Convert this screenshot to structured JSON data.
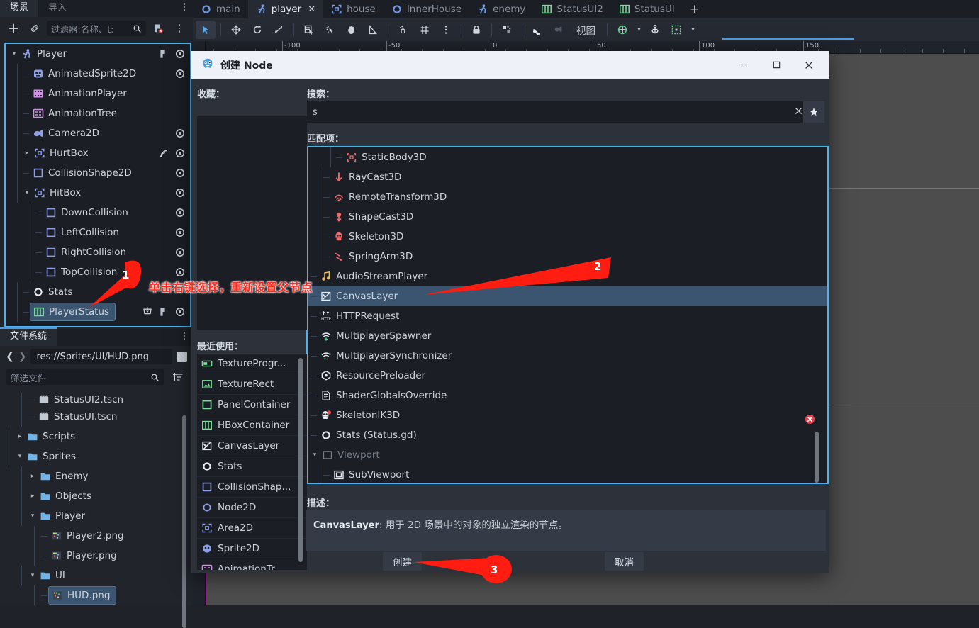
{
  "scene_dock": {
    "tabs": [
      {
        "label": "场景",
        "active": true
      },
      {
        "label": "导入",
        "active": false
      }
    ],
    "toolbar": {
      "add_label": "+",
      "link_icon": "link-icon",
      "filter_placeholder": "过滤器:名称、t:",
      "search_icon": "search-icon",
      "script_icon": "script-remove-icon",
      "menu_icon": "kebab-menu-icon"
    },
    "nodes": [
      {
        "name": "Player",
        "depth": 0,
        "icon": "player-node-icon",
        "icon_color": "#8f9fe8",
        "expand": "down",
        "eye": true,
        "script": true,
        "signal": false
      },
      {
        "name": "AnimatedSprite2D",
        "depth": 1,
        "icon": "animated-sprite-icon",
        "icon_color": "#8f9fe8",
        "expand": "leaf",
        "eye": true,
        "script": false,
        "signal": false
      },
      {
        "name": "AnimationPlayer",
        "depth": 1,
        "icon": "animation-player-icon",
        "icon_color": "#d48fe8",
        "expand": "leaf",
        "eye": false,
        "script": false,
        "signal": false
      },
      {
        "name": "AnimationTree",
        "depth": 1,
        "icon": "animation-tree-icon",
        "icon_color": "#d48fe8",
        "expand": "leaf",
        "eye": false,
        "script": false,
        "signal": false
      },
      {
        "name": "Camera2D",
        "depth": 1,
        "icon": "camera-2d-icon",
        "icon_color": "#8f9fe8",
        "expand": "leaf",
        "eye": true,
        "script": false,
        "signal": false
      },
      {
        "name": "HurtBox",
        "depth": 1,
        "icon": "area-2d-icon",
        "icon_color": "#8f9fe8",
        "expand": "right",
        "eye": true,
        "script": false,
        "signal": true
      },
      {
        "name": "CollisionShape2D",
        "depth": 1,
        "icon": "collision-shape-icon",
        "icon_color": "#8f9fe8",
        "expand": "leaf",
        "eye": true,
        "script": false,
        "signal": false
      },
      {
        "name": "HitBox",
        "depth": 1,
        "icon": "area-2d-icon",
        "icon_color": "#8f9fe8",
        "expand": "down",
        "eye": true,
        "script": false,
        "signal": false
      },
      {
        "name": "DownCollision",
        "depth": 2,
        "icon": "collision-shape-icon",
        "icon_color": "#8f9fe8",
        "expand": "leaf",
        "eye": true,
        "script": false,
        "signal": false
      },
      {
        "name": "LeftCollision",
        "depth": 2,
        "icon": "collision-shape-icon",
        "icon_color": "#8f9fe8",
        "expand": "leaf",
        "eye": true,
        "script": false,
        "signal": false
      },
      {
        "name": "RightCollision",
        "depth": 2,
        "icon": "collision-shape-icon",
        "icon_color": "#8f9fe8",
        "expand": "leaf",
        "eye": true,
        "script": false,
        "signal": false
      },
      {
        "name": "TopCollision",
        "depth": 2,
        "icon": "collision-shape-icon",
        "icon_color": "#8f9fe8",
        "expand": "leaf",
        "eye": true,
        "script": false,
        "signal": false
      },
      {
        "name": "Stats",
        "depth": 1,
        "icon": "node-circle-icon",
        "icon_color": "#e8ecf2",
        "expand": "leaf",
        "eye": false,
        "script": false,
        "signal": false
      },
      {
        "name": "PlayerStatus",
        "depth": 1,
        "icon": "hbox-container-icon",
        "icon_color": "#7ce09a",
        "expand": "leaf",
        "eye": true,
        "script": true,
        "signal": false,
        "selected": true,
        "preview": true
      }
    ]
  },
  "filesystem_dock": {
    "tabs": [
      {
        "label": "文件系统",
        "active": true
      }
    ],
    "path_value": "res://Sprites/UI/HUD.png",
    "back_icon": "chevron-left-icon",
    "forward_icon": "chevron-right-icon",
    "filter_placeholder": "筛选文件",
    "search_icon": "search-icon",
    "sort_icon": "sort-icon",
    "entries": [
      {
        "name": "StatusUI2.tscn",
        "depth": 2,
        "kind": "scene",
        "expand": "leaf",
        "clipped": true
      },
      {
        "name": "StatusUI.tscn",
        "depth": 2,
        "kind": "scene",
        "expand": "leaf"
      },
      {
        "name": "Scripts",
        "depth": 1,
        "kind": "folder",
        "expand": "right"
      },
      {
        "name": "Sprites",
        "depth": 1,
        "kind": "folder",
        "expand": "down"
      },
      {
        "name": "Enemy",
        "depth": 2,
        "kind": "folder",
        "expand": "right"
      },
      {
        "name": "Objects",
        "depth": 2,
        "kind": "folder",
        "expand": "right"
      },
      {
        "name": "Player",
        "depth": 2,
        "kind": "folder",
        "expand": "down"
      },
      {
        "name": "Player2.png",
        "depth": 3,
        "kind": "image",
        "expand": "leaf"
      },
      {
        "name": "Player.png",
        "depth": 3,
        "kind": "image",
        "expand": "leaf"
      },
      {
        "name": "UI",
        "depth": 2,
        "kind": "folder",
        "expand": "down"
      },
      {
        "name": "HUD.png",
        "depth": 3,
        "kind": "image",
        "expand": "leaf",
        "selected": true
      }
    ]
  },
  "editor": {
    "scene_tabs": [
      {
        "label": "main",
        "icon": "node-circle-icon",
        "icon_color": "#6f9ae8",
        "active": false,
        "closable": false
      },
      {
        "label": "player",
        "icon": "player-node-icon",
        "icon_color": "#6f9ae8",
        "active": true,
        "closable": true
      },
      {
        "label": "house",
        "icon": "area-2d-icon",
        "icon_color": "#6f9ae8",
        "active": false,
        "closable": false
      },
      {
        "label": "InnerHouse",
        "icon": "node-circle-icon",
        "icon_color": "#6f9ae8",
        "active": false,
        "closable": false
      },
      {
        "label": "enemy",
        "icon": "player-node-icon",
        "icon_color": "#6f9ae8",
        "active": false,
        "closable": false
      },
      {
        "label": "StatusUI2",
        "icon": "hbox-container-icon",
        "icon_color": "#7ce09a",
        "active": false,
        "closable": false
      },
      {
        "label": "StatusUI",
        "icon": "hbox-container-icon",
        "icon_color": "#7ce09a",
        "active": false,
        "closable": false
      }
    ],
    "add_tab_label": "+",
    "toolbar": {
      "tools": [
        {
          "name": "select-tool-icon",
          "active": true
        },
        {
          "name": "move-tool-icon",
          "active": false
        },
        {
          "name": "rotate-tool-icon",
          "active": false
        },
        {
          "name": "scale-tool-icon",
          "active": false
        },
        {
          "name": "list-select-icon",
          "active": false
        },
        {
          "name": "ruler-select-icon",
          "active": false
        },
        {
          "name": "pan-tool-icon",
          "active": false
        },
        {
          "name": "ruler-tool-icon",
          "active": false
        },
        {
          "name": "snap-mode-icon",
          "active": false
        },
        {
          "name": "grid-snap-icon",
          "active": false
        },
        {
          "name": "snap-options-icon",
          "active": false
        },
        {
          "name": "lock-icon",
          "active": false
        },
        {
          "name": "group-icon",
          "active": false
        },
        {
          "name": "bone-icon",
          "active": false
        },
        {
          "name": "skeleton-options-icon",
          "active": false
        }
      ],
      "view_menu_label": "视图",
      "origin_icon": "origin-center-icon",
      "anchor_icon": "anchor-icon",
      "grid_icon": "grid-visibility-icon",
      "chevron_icon": "chevron-down-icon"
    },
    "ruler": {
      "h_ticks": [
        "-100",
        "-50",
        "0",
        "50",
        "100",
        "150"
      ]
    }
  },
  "dialog": {
    "title": "创建 Node",
    "icon": "godot-logo-icon",
    "window_buttons": {
      "minimize": "—",
      "maximize": "☐",
      "close": "✕"
    },
    "favorites_label": "收藏：",
    "search_label": "搜索：",
    "search_value": "s",
    "clear_icon": "clear-x-icon",
    "favorite_icon": "star-icon",
    "matches_label": "匹配项：",
    "recent_label": "最近使用：",
    "recent_items": [
      {
        "name": "TextureProgr...",
        "icon": "texture-progress-icon",
        "icon_color": "#7ce09a"
      },
      {
        "name": "TextureRect",
        "icon": "texture-rect-icon",
        "icon_color": "#7ce09a"
      },
      {
        "name": "PanelContainer",
        "icon": "panel-container-icon",
        "icon_color": "#7ce09a"
      },
      {
        "name": "HBoxContainer",
        "icon": "hbox-container-icon",
        "icon_color": "#7ce09a"
      },
      {
        "name": "CanvasLayer",
        "icon": "canvas-layer-icon",
        "icon_color": "#e8ecf2"
      },
      {
        "name": "Stats",
        "icon": "node-circle-icon",
        "icon_color": "#e8ecf2"
      },
      {
        "name": "CollisionShap...",
        "icon": "collision-shape-icon",
        "icon_color": "#8f9fe8"
      },
      {
        "name": "Node2D",
        "icon": "node-2d-icon",
        "icon_color": "#8f9fe8"
      },
      {
        "name": "Area2D",
        "icon": "area-2d-icon",
        "icon_color": "#8f9fe8"
      },
      {
        "name": "Sprite2D",
        "icon": "sprite-2d-icon",
        "icon_color": "#8f9fe8"
      },
      {
        "name": "AnimationTr...",
        "icon": "animation-tree-icon",
        "icon_color": "#d48fe8"
      }
    ],
    "matches": [
      {
        "name": "StaticBody3D",
        "depth": 2,
        "icon": "static-body-3d-icon",
        "icon_color": "#f06b6b",
        "expand": "leaf"
      },
      {
        "name": "RayCast3D",
        "depth": 1,
        "icon": "raycast-3d-icon",
        "icon_color": "#f06b6b",
        "expand": "leaf"
      },
      {
        "name": "RemoteTransform3D",
        "depth": 1,
        "icon": "remote-transform-icon",
        "icon_color": "#f06b6b",
        "expand": "leaf"
      },
      {
        "name": "ShapeCast3D",
        "depth": 1,
        "icon": "shapecast-3d-icon",
        "icon_color": "#f06b6b",
        "expand": "leaf"
      },
      {
        "name": "Skeleton3D",
        "depth": 1,
        "icon": "skeleton-3d-icon",
        "icon_color": "#f06b6b",
        "expand": "leaf"
      },
      {
        "name": "SpringArm3D",
        "depth": 1,
        "icon": "spring-arm-icon",
        "icon_color": "#f06b6b",
        "expand": "leaf"
      },
      {
        "name": "AudioStreamPlayer",
        "depth": 0,
        "icon": "audio-stream-icon",
        "icon_color": "#e8c06b",
        "expand": "leaf"
      },
      {
        "name": "CanvasLayer",
        "depth": 0,
        "icon": "canvas-layer-icon",
        "icon_color": "#e8ecf2",
        "expand": "leaf",
        "selected": true
      },
      {
        "name": "HTTPRequest",
        "depth": 0,
        "icon": "http-request-icon",
        "icon_color": "#e8ecf2",
        "expand": "leaf"
      },
      {
        "name": "MultiplayerSpawner",
        "depth": 0,
        "icon": "multiplayer-spawner-icon",
        "icon_color": "#e8ecf2",
        "expand": "leaf"
      },
      {
        "name": "MultiplayerSynchronizer",
        "depth": 0,
        "icon": "multiplayer-sync-icon",
        "icon_color": "#e8ecf2",
        "expand": "leaf"
      },
      {
        "name": "ResourcePreloader",
        "depth": 0,
        "icon": "resource-preloader-icon",
        "icon_color": "#e8ecf2",
        "expand": "leaf"
      },
      {
        "name": "ShaderGlobalsOverride",
        "depth": 0,
        "icon": "shader-globals-icon",
        "icon_color": "#e8ecf2",
        "expand": "leaf"
      },
      {
        "name": "SkeletonIK3D",
        "depth": 0,
        "icon": "skeleton-ik-icon",
        "icon_color": "#e8ecf2",
        "expand": "leaf"
      },
      {
        "name": "Stats (Status.gd)",
        "depth": 0,
        "icon": "node-circle-icon",
        "icon_color": "#e8ecf2",
        "expand": "leaf"
      },
      {
        "name": "Viewport",
        "depth": 0,
        "icon": "viewport-icon",
        "icon_color": "#767d89",
        "expand": "down",
        "dim": true
      },
      {
        "name": "SubViewport",
        "depth": 1,
        "icon": "subviewport-icon",
        "icon_color": "#e8ecf2",
        "expand": "leaf"
      }
    ],
    "error_badge_icon": "error-x-icon",
    "description_label": "描述：",
    "description_name": "CanvasLayer",
    "description_text": ": 用于 2D 场景中的对象的独立渲染的节点。",
    "create_button": "创建",
    "cancel_button": "取消"
  },
  "annotations": {
    "step1_number": "1",
    "step2_number": "2",
    "step3_number": "3",
    "hint_text": "单击右键选择，重新设置父节点",
    "arrow_color": "#ff1c10"
  }
}
